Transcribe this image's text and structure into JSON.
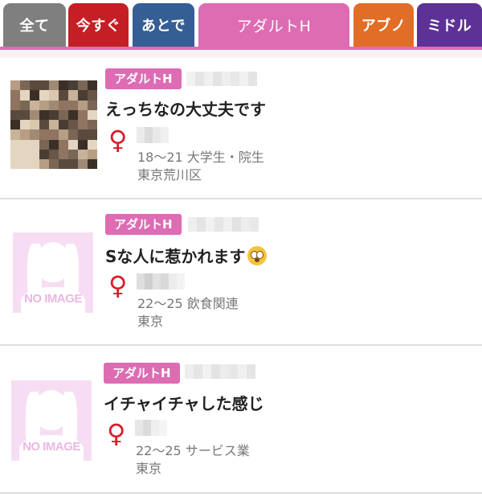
{
  "tabs": [
    {
      "label": "全て",
      "color": "#7f7f7f"
    },
    {
      "label": "今すぐ",
      "color": "#c41f24"
    },
    {
      "label": "あとで",
      "color": "#355e94"
    },
    {
      "label": "アダルトH",
      "color": "#dd6cb3"
    },
    {
      "label": "アブノ",
      "color": "#e26d26"
    },
    {
      "label": "ミドル",
      "color": "#5e3197"
    }
  ],
  "posts": [
    {
      "category": "アダルトH",
      "title": "えっちなの大丈夫です",
      "gender_icon": "female-icon",
      "demographics": "18〜21 大学生・院生",
      "location": "東京荒川区",
      "thumbnail": "mosaic-photo"
    },
    {
      "category": "アダルトH",
      "title": "Sな人に惹かれます",
      "title_emoji": "flushed-face-emoji",
      "gender_icon": "female-icon",
      "demographics": "22〜25 飲食関連",
      "location": "東京",
      "thumbnail": "no-image",
      "no_image_text": "NO IMAGE"
    },
    {
      "category": "アダルトH",
      "title": "イチャイチャした感じ",
      "gender_icon": "female-icon",
      "demographics": "22〜25 サービス業",
      "location": "東京",
      "thumbnail": "no-image",
      "no_image_text": "NO IMAGE"
    }
  ],
  "colors": {
    "accent_pink": "#dd6cb3",
    "female_red": "#d51e2c",
    "meta_gray": "#777777"
  }
}
